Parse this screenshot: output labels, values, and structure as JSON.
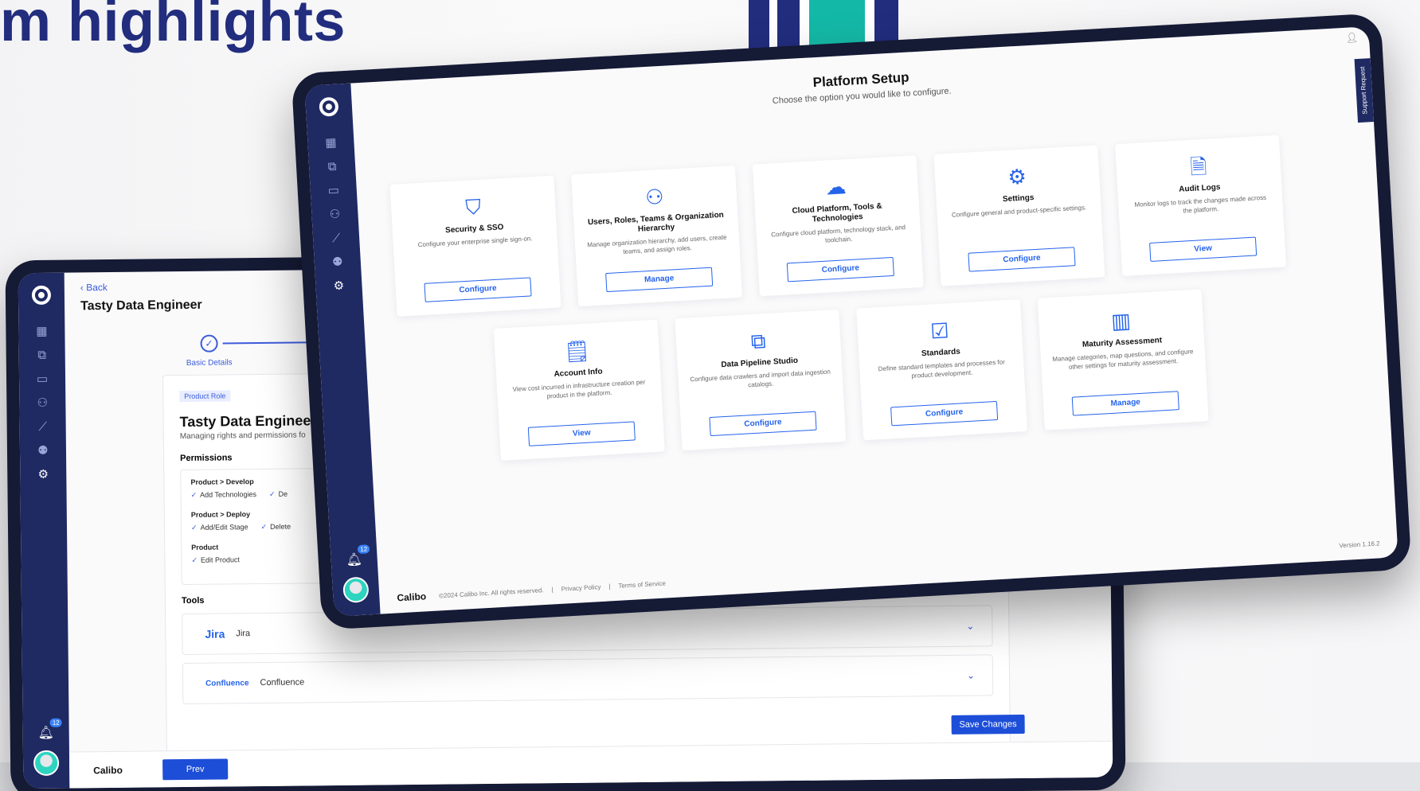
{
  "heading": "m highlights",
  "colors": {
    "brand_navy": "#222d7e",
    "accent_blue": "#2563eb",
    "teal": "#14b8a6",
    "sidebar": "#1f2a63"
  },
  "sidebar_icons": [
    "grid-icon",
    "box-icon",
    "monitor-icon",
    "users-icon",
    "chart-icon",
    "people-icon",
    "gear-icon"
  ],
  "notifications": "12",
  "back_screen": {
    "back_label": "‹ Back",
    "title": "Tasty Data Engineer",
    "step_label": "Basic Details",
    "role_badge": "Product Role",
    "role_title": "Tasty Data Engineer",
    "role_subtitle": "Managing rights and permissions fo",
    "permissions_heading": "Permissions",
    "permission_groups": [
      {
        "title": "Product > Develop",
        "items": [
          "Add Technologies",
          "De"
        ]
      },
      {
        "title": "Product > Deploy",
        "items": [
          "Add/Edit Stage",
          "Delete"
        ]
      },
      {
        "title": "Product",
        "items": [
          "Edit Product"
        ]
      }
    ],
    "tools_heading": "Tools",
    "tools": [
      {
        "logo": "Jira",
        "name": "Jira"
      },
      {
        "logo": "Confluence",
        "name": "Confluence"
      }
    ],
    "brand": "Calibo",
    "prev_label": "Prev",
    "save_label": "Save Changes"
  },
  "front_screen": {
    "title": "Platform Setup",
    "subtitle": "Choose the option you would like to configure.",
    "support_tab": "Support Request",
    "cards_row1": [
      {
        "icon": "shield-icon",
        "title": "Security & SSO",
        "desc": "Configure your enterprise single sign-on.",
        "btn": "Configure"
      },
      {
        "icon": "team-icon",
        "title": "Users, Roles, Teams & Organization Hierarchy",
        "desc": "Manage organization hierarchy, add users, create teams, and assign roles.",
        "btn": "Manage"
      },
      {
        "icon": "cloud-icon",
        "title": "Cloud Platform, Tools & Technologies",
        "desc": "Configure cloud platform, technology stack, and toolchain.",
        "btn": "Configure"
      },
      {
        "icon": "gear-icon",
        "title": "Settings",
        "desc": "Configure general and product-specific settings.",
        "btn": "Configure"
      },
      {
        "icon": "document-icon",
        "title": "Audit Logs",
        "desc": "Monitor logs to track the changes made across the platform.",
        "btn": "View"
      }
    ],
    "cards_row2": [
      {
        "icon": "invoice-icon",
        "title": "Account Info",
        "desc": "View cost incurred in infrastructure creation per product in the platform.",
        "btn": "View"
      },
      {
        "icon": "pipeline-icon",
        "title": "Data Pipeline Studio",
        "desc": "Configure data crawlers and import data ingestion catalogs.",
        "btn": "Configure"
      },
      {
        "icon": "checklist-icon",
        "title": "Standards",
        "desc": "Define standard templates and processes for product development.",
        "btn": "Configure"
      },
      {
        "icon": "bar-chart-icon",
        "title": "Maturity Assessment",
        "desc": "Manage categories, map questions, and configure other settings for maturity assessment.",
        "btn": "Manage"
      }
    ],
    "footer_brand": "Calibo",
    "footer_copyright": "©2024 Calibo Inc. All rights reserved.",
    "footer_sep": "|",
    "footer_privacy": "Privacy Policy",
    "footer_terms": "Terms of Service",
    "version": "Version 1.16.2"
  }
}
